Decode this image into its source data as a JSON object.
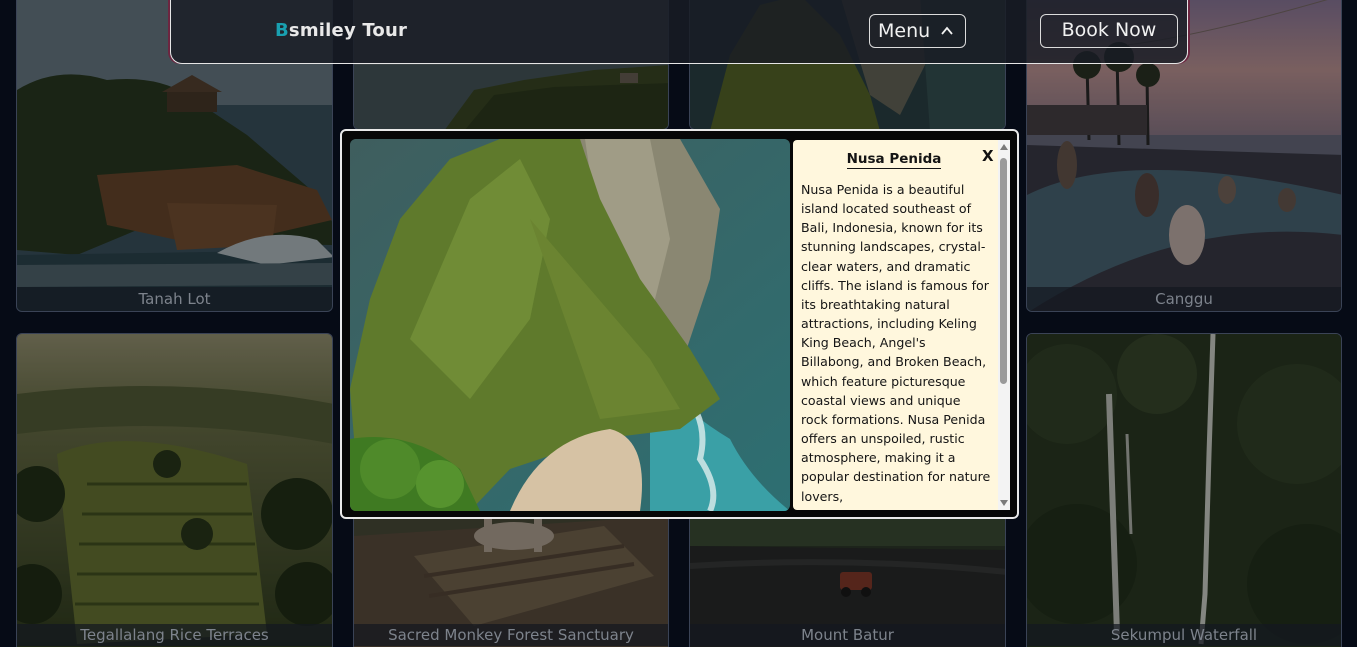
{
  "header": {
    "brand_initial": "B",
    "brand_rest": "smiley Tour",
    "menu_label": "Menu",
    "menu_icon": "chevron-up-icon",
    "book_label": "Book Now"
  },
  "destinations": [
    {
      "name": "Tanah Lot"
    },
    {
      "name": ""
    },
    {
      "name": ""
    },
    {
      "name": "Canggu"
    },
    {
      "name": "Tegallalang Rice Terraces"
    },
    {
      "name": "Sacred Monkey Forest Sanctuary"
    },
    {
      "name": "Mount Batur"
    },
    {
      "name": "Sekumpul Waterfall"
    }
  ],
  "modal": {
    "title": "Nusa Penida",
    "close_label": "X",
    "description": "Nusa Penida is a beautiful island located southeast of Bali, Indonesia, known for its stunning landscapes, crystal-clear waters, and dramatic cliffs. The island is famous for its breathtaking natural attractions, including Keling King Beach, Angel's Billabong, and Broken Beach, which feature picturesque coastal views and unique rock formations. Nusa Penida offers an unspoiled, rustic atmosphere, making it a popular destination for nature lovers,"
  },
  "colors": {
    "page_bg": "#060b16",
    "brand_accent": "#19a0b0",
    "info_panel_bg": "#fff7dd",
    "header_bg": "#181c24"
  }
}
